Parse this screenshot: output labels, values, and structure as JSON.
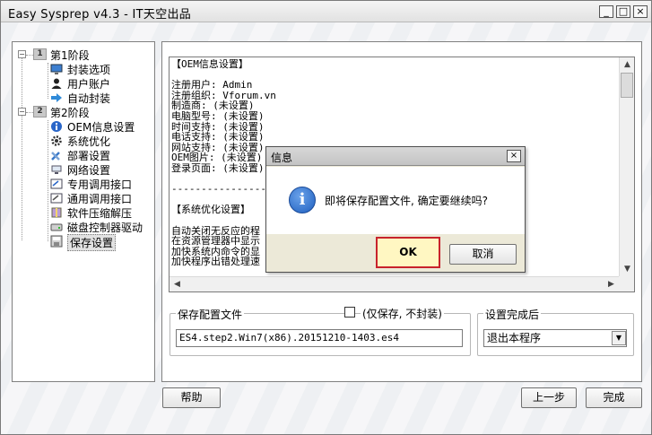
{
  "window": {
    "title": "Easy Sysprep v4.3 - IT天空出品",
    "minimize_glyph": "_",
    "maximize_glyph": "□",
    "close_glyph": "×"
  },
  "sidebar": {
    "stage1": {
      "num": "1",
      "label": "第1阶段",
      "expander": "−"
    },
    "stage1_items": [
      {
        "label": "封装选项",
        "icon": "monitor-icon"
      },
      {
        "label": "用户账户",
        "icon": "user-icon"
      },
      {
        "label": "自动封装",
        "icon": "arrow-icon"
      }
    ],
    "stage2": {
      "num": "2",
      "label": "第2阶段",
      "expander": "−"
    },
    "stage2_items": [
      {
        "label": "OEM信息设置",
        "icon": "info-icon"
      },
      {
        "label": "系统优化",
        "icon": "gear-icon"
      },
      {
        "label": "部署设置",
        "icon": "tools-icon"
      },
      {
        "label": "网络设置",
        "icon": "network-icon"
      },
      {
        "label": "专用调用接口",
        "icon": "window-icon"
      },
      {
        "label": "通用调用接口",
        "icon": "window-icon"
      },
      {
        "label": "软件压缩解压",
        "icon": "archive-icon"
      },
      {
        "label": "磁盘控制器驱动",
        "icon": "disk-icon"
      },
      {
        "label": "保存设置",
        "icon": "save-icon"
      }
    ]
  },
  "summary": {
    "lines": [
      "【OEM信息设置】",
      "",
      "注册用户: Admin",
      "注册组织: Vforum.vn",
      "制造商: (未设置)",
      "电脑型号: (未设置)",
      "时间支持: (未设置)",
      "电话支持: (未设置)",
      "网站支持: (未设置)",
      "OEM图片: (未设置)",
      "登录页面: (未设置)",
      "",
      "-------------------------------------------",
      "",
      "【系统优化设置】",
      "",
      "自动关闭无反应的程",
      "在资源管理器中显示",
      "加快系统内命令的显",
      "加快程序出错处理速"
    ],
    "scroll_up": "▲",
    "scroll_down": "▼",
    "scroll_left": "◀",
    "scroll_right": "▶"
  },
  "save_config": {
    "group_title": "保存配置文件",
    "checkbox_label": "(仅保存, 不封装)",
    "filename": "ES4.step2.Win7(x86).20151210-1403.es4"
  },
  "completion": {
    "group_title": "设置完成后",
    "selected_option": "退出本程序",
    "dropdown_arrow": "▼"
  },
  "buttons": {
    "help": "帮助",
    "back": "上一步",
    "finish": "完成"
  },
  "dialog": {
    "title": "信息",
    "close_glyph": "×",
    "icon_glyph": "i",
    "message": "即将保存配置文件, 确定要继续吗?",
    "ok_label": "OK",
    "cancel_label": "取消"
  }
}
